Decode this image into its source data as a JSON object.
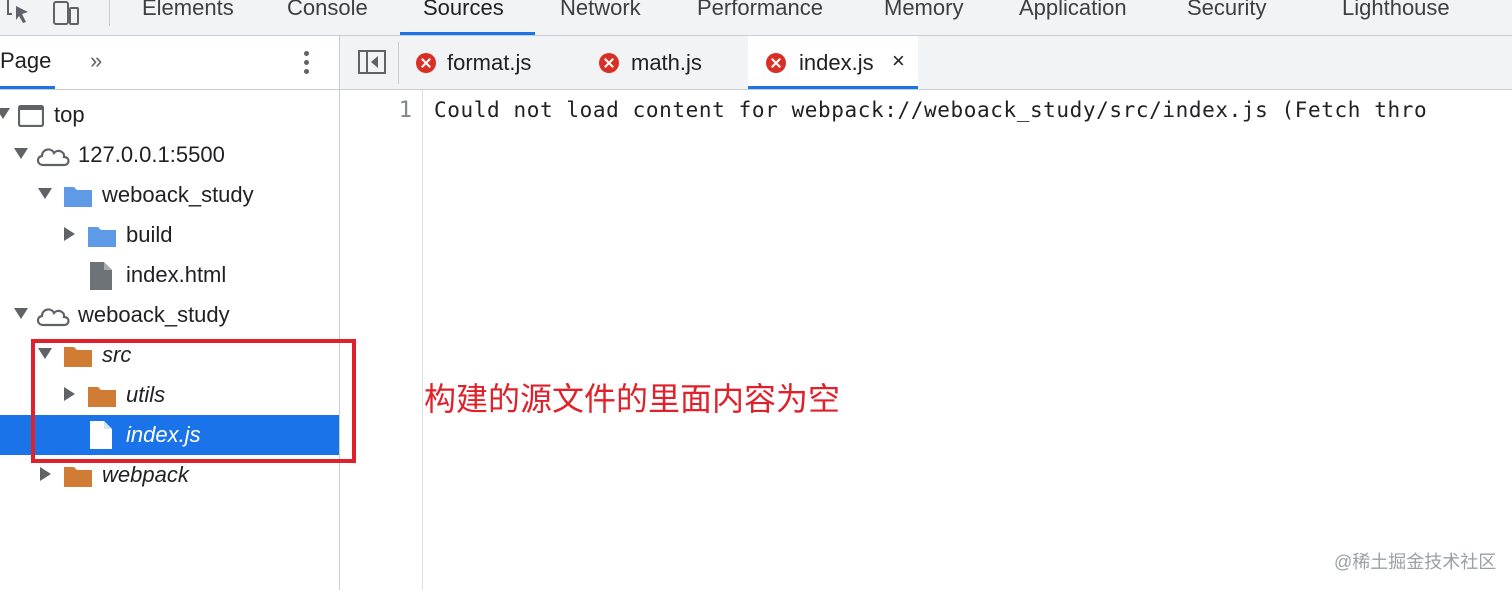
{
  "devtools_tabs": [
    {
      "label": "Elements"
    },
    {
      "label": "Console"
    },
    {
      "label": "Sources"
    },
    {
      "label": "Network"
    },
    {
      "label": "Performance"
    },
    {
      "label": "Memory"
    },
    {
      "label": "Application"
    },
    {
      "label": "Security"
    },
    {
      "label": "Lighthouse"
    }
  ],
  "active_devtools_tab": "Sources",
  "navigator": {
    "tab_label": "Page",
    "more_label": "»",
    "menu_icon": "kebab-menu-icon",
    "tree": [
      {
        "label": "top",
        "icon": "frame-icon",
        "expanded": true
      },
      {
        "label": "127.0.0.1:5500",
        "icon": "cloud-icon",
        "expanded": true
      },
      {
        "label": "weboack_study",
        "icon": "folder-icon",
        "expanded": true
      },
      {
        "label": "build",
        "icon": "folder-icon",
        "expanded": false
      },
      {
        "label": "index.html",
        "icon": "file-icon"
      },
      {
        "label": "weboack_study",
        "icon": "cloud-icon",
        "expanded": true
      },
      {
        "label": "src",
        "icon": "folder-icon",
        "expanded": true
      },
      {
        "label": "utils",
        "icon": "folder-icon",
        "expanded": false
      },
      {
        "label": "index.js",
        "icon": "file-icon",
        "selected": true
      },
      {
        "label": "webpack",
        "icon": "folder-icon",
        "expanded": false
      }
    ]
  },
  "editor": {
    "tabs": [
      {
        "label": "format.js",
        "status": "error"
      },
      {
        "label": "math.js",
        "status": "error"
      },
      {
        "label": "index.js",
        "status": "error",
        "active": true,
        "close": "×"
      }
    ],
    "lines": [
      {
        "number": "1",
        "text": "Could not load content for webpack://weboack_study/src/index.js (Fetch thro"
      }
    ]
  },
  "annotation": "构建的源文件的里面内容为空",
  "watermark": "@稀土掘金技术社区",
  "colors": {
    "accent": "#1a73e8",
    "error": "#d93025",
    "annotation_red": "#e0202a",
    "folder_blue": "#5e9ae6",
    "folder_orange": "#d07c35"
  }
}
